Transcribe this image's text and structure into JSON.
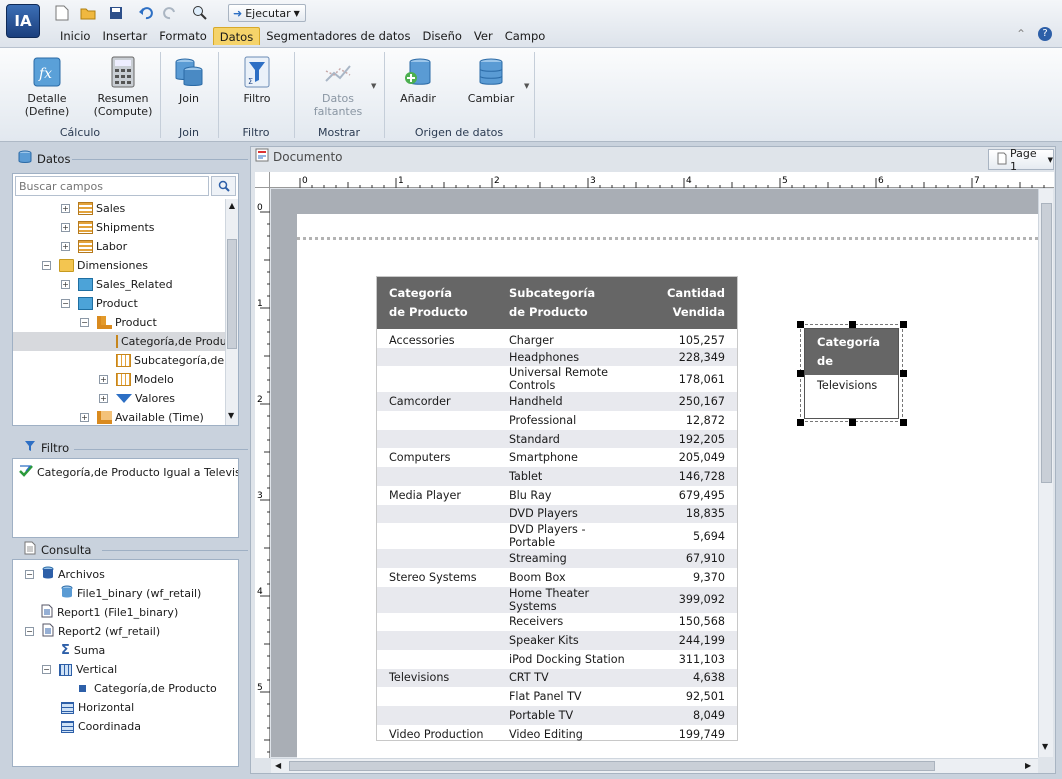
{
  "app": {
    "logo_text": "IA",
    "run_label": "Ejecutar"
  },
  "menus": [
    "Inicio",
    "Insertar",
    "Formato",
    "Datos",
    "Segmentadores de datos",
    "Diseño",
    "Ver",
    "Campo"
  ],
  "active_menu": "Datos",
  "ribbon": {
    "detalle": "Detalle",
    "detalle2": "(Define)",
    "resumen": "Resumen",
    "resumen2": "(Compute)",
    "join": "Join",
    "filtro": "Filtro",
    "datos_faltantes": "Datos",
    "datos_faltantes2": "faltantes",
    "anadir": "Añadir",
    "cambiar": "Cambiar",
    "grp_calculo": "Cálculo",
    "grp_join": "Join",
    "grp_filtro": "Filtro",
    "grp_mostrar": "Mostrar",
    "grp_origen": "Origen de datos"
  },
  "datos_panel": {
    "title": "Datos",
    "search_placeholder": "Buscar campos",
    "tree": [
      "Sales",
      "Shipments",
      "Labor",
      "Dimensiones",
      "Sales_Related",
      "Product",
      "Product",
      "Categoría,de Producto",
      "Subcategoría,de Producto",
      "Modelo",
      "Valores",
      "Available (Time)"
    ]
  },
  "filtro_panel": {
    "title": "Filtro",
    "item": "Categoría,de Producto Igual a Televisions"
  },
  "consulta_panel": {
    "title": "Consulta",
    "tree": [
      "Archivos",
      "File1_binary (wf_retail)",
      "Report1 (File1_binary)",
      "Report2 (wf_retail)",
      "Suma",
      "Vertical",
      "Categoría,de Producto",
      "Horizontal",
      "Coordinada"
    ]
  },
  "document": {
    "title": "Documento",
    "page_label": "Page 1"
  },
  "ruler_h": [
    "0",
    "1",
    "2",
    "3",
    "4",
    "5",
    "6",
    "7"
  ],
  "ruler_v": [
    "0",
    "1",
    "2",
    "3",
    "4",
    "5"
  ],
  "report": {
    "headers": [
      [
        "Categoría",
        "de Producto"
      ],
      [
        "Subcategoría",
        "de Producto"
      ],
      [
        "Cantidad",
        "Vendida"
      ]
    ],
    "rows": [
      [
        "Accessories",
        "Charger",
        "105,257"
      ],
      [
        "",
        "Headphones",
        "228,349"
      ],
      [
        "",
        "Universal Remote Controls",
        "178,061"
      ],
      [
        "Camcorder",
        "Handheld",
        "250,167"
      ],
      [
        "",
        "Professional",
        "12,872"
      ],
      [
        "",
        "Standard",
        "192,205"
      ],
      [
        "Computers",
        "Smartphone",
        "205,049"
      ],
      [
        "",
        "Tablet",
        "146,728"
      ],
      [
        "Media Player",
        "Blu Ray",
        "679,495"
      ],
      [
        "",
        "DVD Players",
        "18,835"
      ],
      [
        "",
        "DVD Players - Portable",
        "5,694"
      ],
      [
        "",
        "Streaming",
        "67,910"
      ],
      [
        "Stereo Systems",
        "Boom Box",
        "9,370"
      ],
      [
        "",
        "Home Theater Systems",
        "399,092"
      ],
      [
        "",
        "Receivers",
        "150,568"
      ],
      [
        "",
        "Speaker Kits",
        "244,199"
      ],
      [
        "",
        "iPod Docking Station",
        "311,103"
      ],
      [
        "Televisions",
        "CRT TV",
        "4,638"
      ],
      [
        "",
        "Flat Panel TV",
        "92,501"
      ],
      [
        "",
        "Portable TV",
        "8,049"
      ],
      [
        "Video Production",
        "Video Editing",
        "199,749"
      ]
    ]
  },
  "filter_box": {
    "header1": "Categoría",
    "header2": "de Producto",
    "value": "Televisions"
  }
}
